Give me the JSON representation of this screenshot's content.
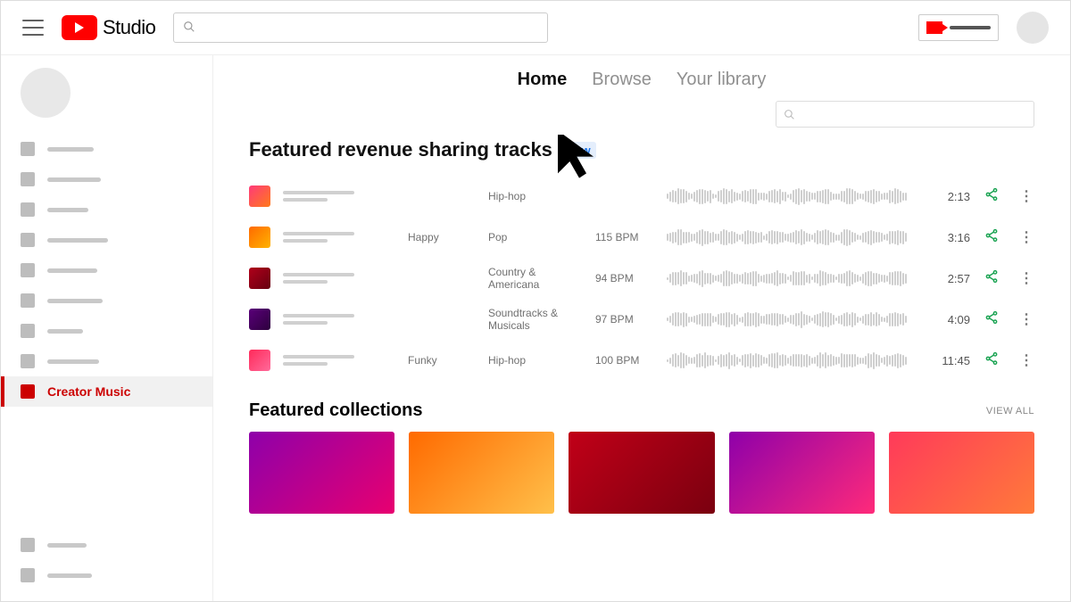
{
  "header": {
    "logo_text": "Studio",
    "search_placeholder": "",
    "create_label": ""
  },
  "sidebar": {
    "items": [
      {
        "icon": "dashboard-icon"
      },
      {
        "icon": "content-icon"
      },
      {
        "icon": "playlists-icon"
      },
      {
        "icon": "analytics-icon"
      },
      {
        "icon": "comments-icon"
      },
      {
        "icon": "subtitles-icon"
      },
      {
        "icon": "monetization-icon"
      },
      {
        "icon": "customization-icon"
      }
    ],
    "active_label": "Creator Music",
    "bottom": [
      {
        "icon": "settings-icon"
      },
      {
        "icon": "feedback-icon"
      }
    ]
  },
  "tabs": {
    "items": [
      "Home",
      "Browse",
      "Your library"
    ],
    "active": "Home"
  },
  "filter": {
    "placeholder": ""
  },
  "section": {
    "title": "Featured revenue sharing tracks",
    "badge": "New"
  },
  "tracks": [
    {
      "thumb_class": "g1",
      "mood": "",
      "genre": "Hip-hop",
      "bpm": "",
      "duration": "2:13"
    },
    {
      "thumb_class": "g2",
      "mood": "Happy",
      "genre": "Pop",
      "bpm": "115 BPM",
      "duration": "3:16"
    },
    {
      "thumb_class": "g3",
      "mood": "",
      "genre": "Country & Americana",
      "bpm": "94 BPM",
      "duration": "2:57"
    },
    {
      "thumb_class": "g4",
      "mood": "",
      "genre": "Soundtracks & Musicals",
      "bpm": "97 BPM",
      "duration": "4:09"
    },
    {
      "thumb_class": "g5",
      "mood": "Funky",
      "genre": "Hip-hop",
      "bpm": "100 BPM",
      "duration": "11:45"
    }
  ],
  "collections": {
    "title": "Featured collections",
    "view_all": "VIEW ALL",
    "cards": [
      "gc1",
      "gc2",
      "gc3",
      "gc4",
      "gc5"
    ]
  }
}
